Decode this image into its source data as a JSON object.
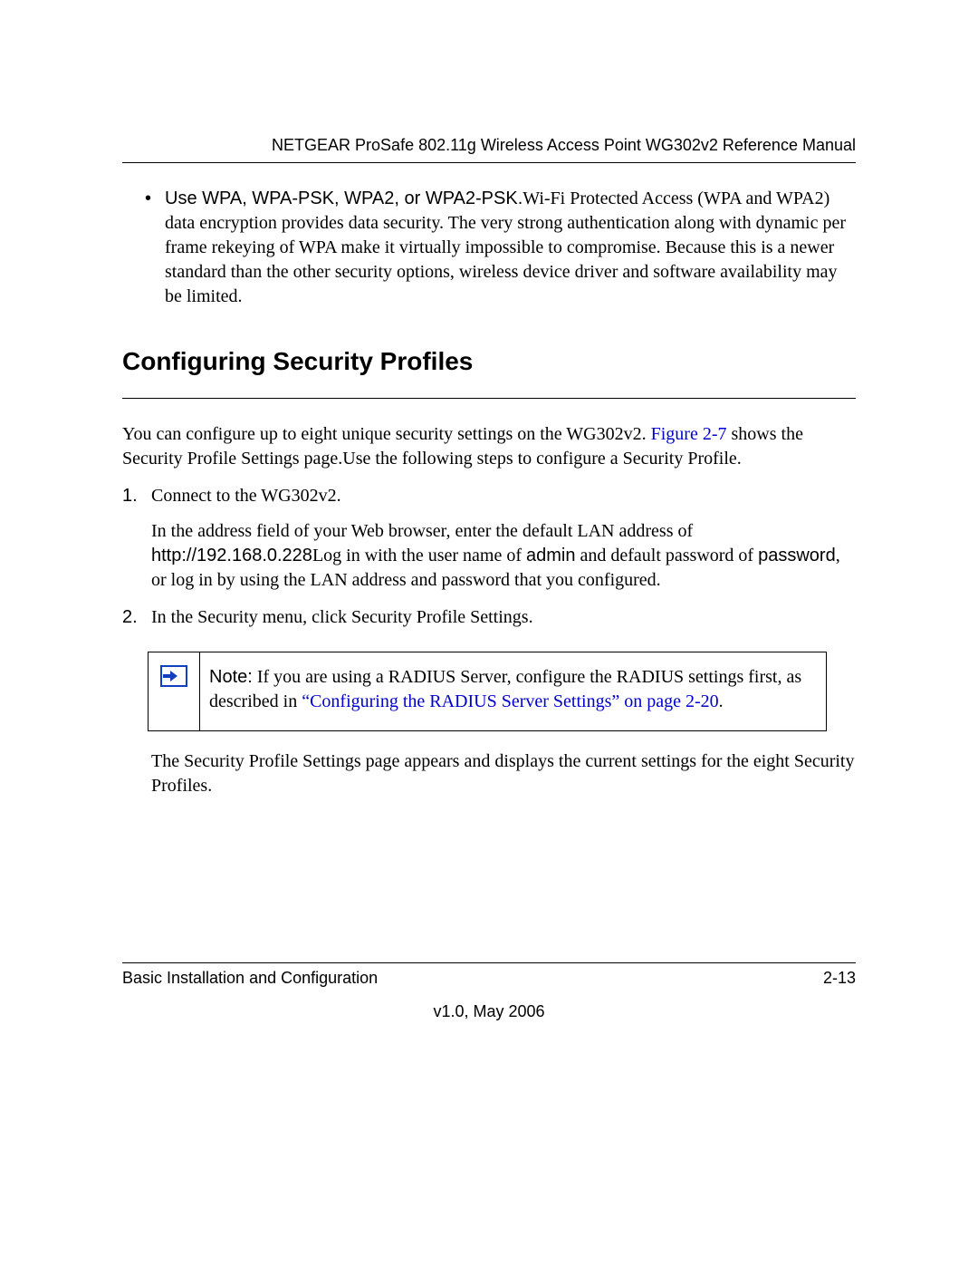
{
  "header": {
    "title": "NETGEAR ProSafe 802.11g Wireless Access Point WG302v2 Reference Manual"
  },
  "bullet": {
    "lead_sans": "Use WPA, WPA-PSK, WPA2, or WPA2-PSK.",
    "rest": "Wi-Fi Protected Access (WPA and WPA2) data encryption provides data security. The very strong authentication along with dynamic per frame rekeying of WPA make it virtually impossible to compromise. Because this is a newer standard than the other security options, wireless device driver and software availability may be limited."
  },
  "section_heading": "Configuring Security Profiles",
  "intro": {
    "part1": "You can configure up to eight unique security settings on the WG302v2. ",
    "link": "Figure 2-7",
    "part2": " shows the Security Profile Settings page.Use the following steps to configure a Security Profile."
  },
  "steps": {
    "s1": {
      "num": "1.",
      "line1": "Connect to the WG302v2.",
      "p2a": "In the address field of your Web browser, enter the default LAN address of ",
      "url": "http://192.168.0.228",
      "p2b": "Log in with the user name of ",
      "admin": "admin",
      "p2c": " and default password of ",
      "password": "password",
      "p2d": ", or log in by using the LAN address and password that you configured."
    },
    "s2": {
      "num": "2.",
      "line1": "In the Security menu, click Security Profile Settings.",
      "after": "The Security Profile Settings page appears and displays the current settings for the eight Security Profiles."
    }
  },
  "note": {
    "label": "Note:",
    "text1": " If you are using a RADIUS Server, configure the RADIUS settings first, as described in ",
    "link": "“Configuring the RADIUS Server Settings” on page 2-20",
    "tail": "."
  },
  "footer": {
    "left": "Basic Installation and Configuration",
    "right": "2-13",
    "version": "v1.0, May 2006"
  }
}
